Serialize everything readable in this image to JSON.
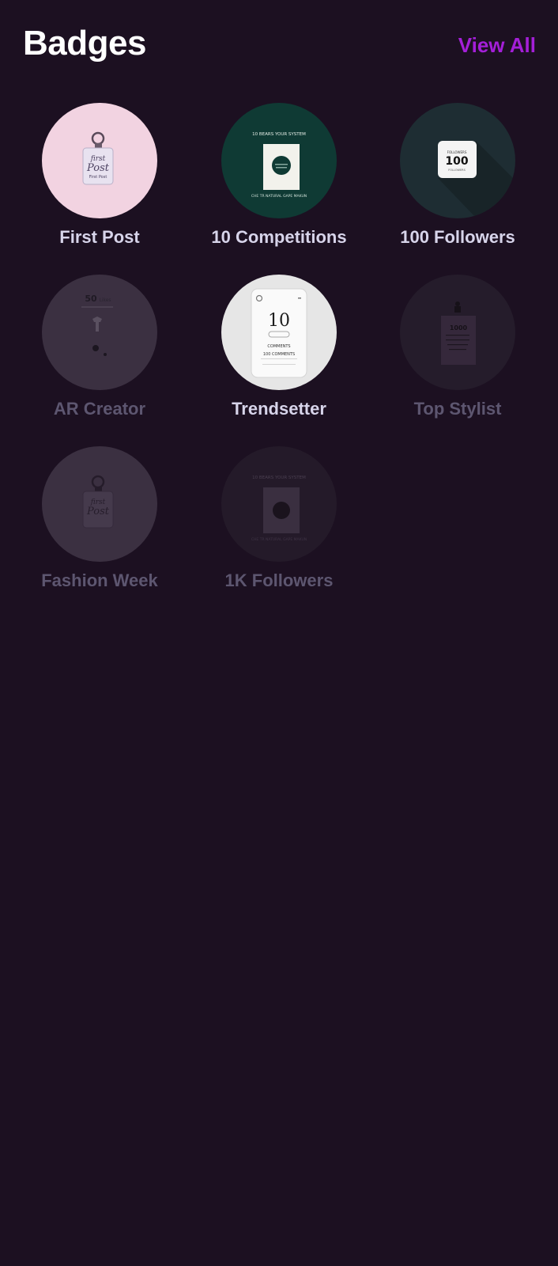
{
  "header": {
    "title": "Badges",
    "view_all": "View All"
  },
  "badges": [
    {
      "label": "First Post",
      "locked": false,
      "icon": "first-post-badge-icon",
      "art": {
        "line1": "first",
        "line2": "Post",
        "line3": "First Post"
      }
    },
    {
      "label": "10 Competitions",
      "locked": false,
      "icon": "competitions-badge-icon",
      "art": {
        "top": "10 BEARS YOUR SYSTEM",
        "bottom": "CHE TR NATURAL GAPE MAKUN"
      }
    },
    {
      "label": "100 Followers",
      "locked": false,
      "icon": "followers-badge-icon",
      "art": {
        "top": "FOLLOWERS",
        "num": "100",
        "bottom": "FOLLOWERS"
      }
    },
    {
      "label": "AR Creator",
      "locked": true,
      "icon": "ar-creator-badge-icon",
      "art": {
        "num": "50",
        "word": "Likes"
      }
    },
    {
      "label": "Trendsetter",
      "locked": false,
      "icon": "trendsetter-badge-icon",
      "art": {
        "num": "10",
        "line1": "COMMENTS",
        "line2": "100 COMMENTS"
      }
    },
    {
      "label": "Top Stylist",
      "locked": true,
      "icon": "top-stylist-badge-icon",
      "art": {
        "num": "1000"
      }
    },
    {
      "label": "Fashion Week",
      "locked": true,
      "icon": "fashion-week-badge-icon",
      "art": {
        "line1": "first",
        "line2": "Post"
      }
    },
    {
      "label": "1K Followers",
      "locked": true,
      "icon": "1k-followers-badge-icon",
      "art": {
        "top": "10 BEARS YOUR SYSTEM",
        "bottom": "CHE TR NATURAL GAPE MAKUN"
      }
    }
  ]
}
